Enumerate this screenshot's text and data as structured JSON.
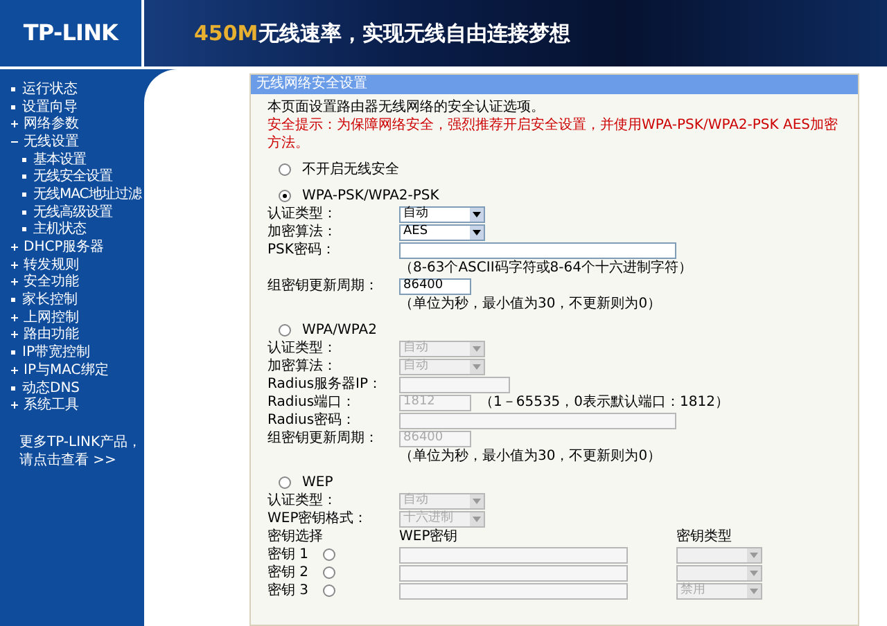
{
  "header": {
    "logo": "TP-LINK",
    "slogan_highlight": "450M",
    "slogan": "无线速率，实现无线自由连接梦想"
  },
  "sidebar": {
    "items": [
      {
        "label": "运行状态",
        "kind": "leaf"
      },
      {
        "label": "设置向导",
        "kind": "leaf"
      },
      {
        "label": "网络参数",
        "kind": "group",
        "expanded": false
      },
      {
        "label": "无线设置",
        "kind": "group",
        "expanded": true,
        "children": [
          {
            "label": "基本设置"
          },
          {
            "label": "无线安全设置"
          },
          {
            "label": "无线MAC地址过滤"
          },
          {
            "label": "无线高级设置"
          },
          {
            "label": "主机状态"
          }
        ]
      },
      {
        "label": "DHCP服务器",
        "kind": "group",
        "expanded": false
      },
      {
        "label": "转发规则",
        "kind": "group",
        "expanded": false
      },
      {
        "label": "安全功能",
        "kind": "group",
        "expanded": false
      },
      {
        "label": "家长控制",
        "kind": "leaf"
      },
      {
        "label": "上网控制",
        "kind": "group",
        "expanded": false
      },
      {
        "label": "路由功能",
        "kind": "group",
        "expanded": false
      },
      {
        "label": "IP带宽控制",
        "kind": "leaf"
      },
      {
        "label": "IP与MAC绑定",
        "kind": "group",
        "expanded": false
      },
      {
        "label": "动态DNS",
        "kind": "leaf"
      },
      {
        "label": "系统工具",
        "kind": "group",
        "expanded": false
      }
    ],
    "more_line1": "更多TP-LINK产品，",
    "more_line2": "请点击查看 >>"
  },
  "panel": {
    "title": "无线网络安全设置",
    "intro": "本页面设置路由器无线网络的安全认证选项。",
    "warning": "安全提示：为保障网络安全，强烈推荐开启安全设置，并使用WPA-PSK/WPA2-PSK AES加密方法。",
    "sections": [
      {
        "label": "不开启无线安全",
        "selected": false
      },
      {
        "label": "WPA-PSK/WPA2-PSK",
        "selected": true,
        "fields": [
          {
            "kind": "select",
            "label": "认证类型：",
            "value": "自动"
          },
          {
            "kind": "select",
            "label": "加密算法：",
            "value": "AES"
          },
          {
            "kind": "password",
            "label": "PSK密码："
          },
          {
            "kind": "hint",
            "text": "（8-63个ASCII码字符或8-64个十六进制字符）"
          },
          {
            "kind": "number",
            "label": "组密钥更新周期：",
            "value": "86400"
          },
          {
            "kind": "hint",
            "text": "（单位为秒，最小值为30，不更新则为0）"
          }
        ]
      },
      {
        "label": "WPA/WPA2",
        "selected": false,
        "fields": [
          {
            "kind": "select",
            "label": "认证类型：",
            "value": "自动"
          },
          {
            "kind": "select",
            "label": "加密算法：",
            "value": "自动"
          },
          {
            "kind": "ip",
            "label": "Radius服务器IP："
          },
          {
            "kind": "number",
            "label": "Radius端口：",
            "value": "1812",
            "note": "（1－65535，0表示默认端口：1812）"
          },
          {
            "kind": "password",
            "label": "Radius密码："
          },
          {
            "kind": "number",
            "label": "组密钥更新周期：",
            "value": "86400"
          },
          {
            "kind": "hint",
            "text": "（单位为秒，最小值为30，不更新则为0）"
          }
        ]
      },
      {
        "label": "WEP",
        "selected": false,
        "fields": [
          {
            "kind": "select",
            "label": "认证类型：",
            "value": "自动"
          },
          {
            "kind": "select",
            "label": "WEP密钥格式：",
            "value": "十六进制"
          },
          {
            "kind": "keyhead",
            "label": "密钥选择",
            "key": "WEP密钥",
            "type": "密钥类型"
          },
          {
            "kind": "key",
            "label": "密钥 1",
            "selected": false
          },
          {
            "kind": "key",
            "label": "密钥 2",
            "selected": false
          },
          {
            "kind": "key",
            "label": "密钥 3",
            "selected": false,
            "type": "禁用"
          }
        ]
      }
    ]
  }
}
